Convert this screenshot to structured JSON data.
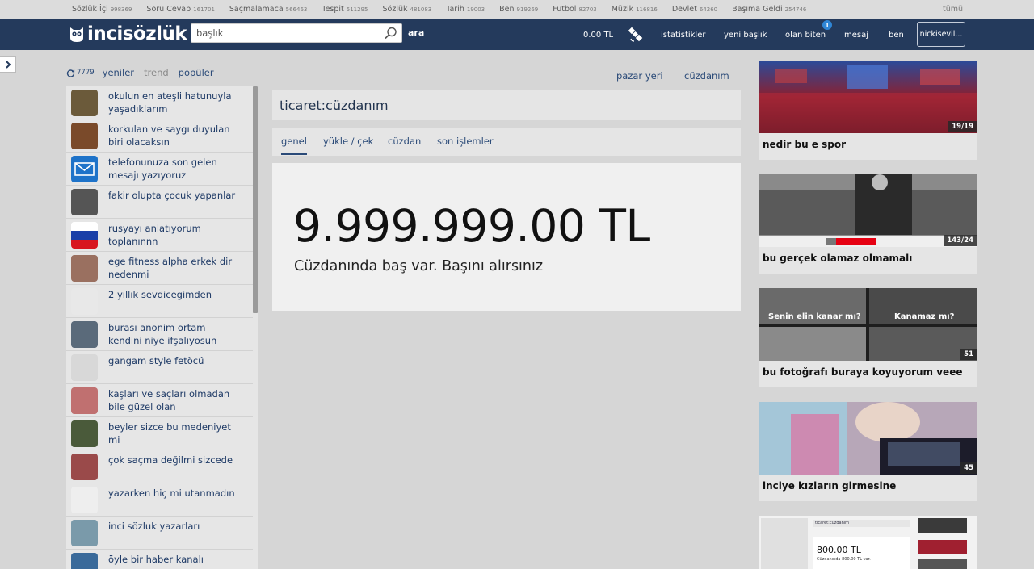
{
  "category_bar": {
    "items": [
      {
        "label": "Sözlük İçi",
        "count": "998369"
      },
      {
        "label": "Soru Cevap",
        "count": "161701"
      },
      {
        "label": "Saçmalamaca",
        "count": "566463"
      },
      {
        "label": "Tespit",
        "count": "511295"
      },
      {
        "label": "Sözlük",
        "count": "481083"
      },
      {
        "label": "Tarih",
        "count": "19003"
      },
      {
        "label": "Ben",
        "count": "919269"
      },
      {
        "label": "Futbol",
        "count": "82703"
      },
      {
        "label": "Müzik",
        "count": "116816"
      },
      {
        "label": "Devlet",
        "count": "64260"
      },
      {
        "label": "Başıma Geldi",
        "count": "254746"
      }
    ],
    "all_label": "tümü"
  },
  "header": {
    "logo": "incisözlük",
    "search_placeholder": "başlık",
    "search_button": "ara",
    "balance": "0.00 TL",
    "nav_stats": "istatistikler",
    "nav_new_title": "yeni başlık",
    "nav_news": "olan biten",
    "news_badge": "1",
    "nav_messages": "mesaj",
    "nav_me": "ben",
    "nick": "nickisevil..."
  },
  "left": {
    "refresh_count": "7779",
    "tab_new": "yeniler",
    "tab_trend": "trend",
    "tab_popular": "popüler",
    "topics": [
      {
        "title": "okulun en ateşli hatunuyla yaşadıklarım",
        "thumb": "#6b5a3a"
      },
      {
        "title": "korkulan ve saygı duyulan biri olacaksın",
        "thumb": "#7a4a2a"
      },
      {
        "title": "telefonunuza son gelen mesajı yazıyoruz",
        "thumb": "#1e73c9"
      },
      {
        "title": "fakir olupta çocuk yapanlar",
        "thumb": "#555555"
      },
      {
        "title": "rusyayı anlatıyorum toplanınnn",
        "thumb": "#ffffff"
      },
      {
        "title": "ege fitness alpha erkek dir nedenmi",
        "thumb": "#9a7060"
      },
      {
        "title": "2 yıllık sevdicegimden",
        "thumb": "#e8e8e8"
      },
      {
        "title": "burası anonim ortam kendini niye ifşalıyosun",
        "thumb": "#5a6a7a"
      },
      {
        "title": "gangam style fetöcü",
        "thumb": "#d8d8d8"
      },
      {
        "title": "kaşları ve saçları olmadan bile güzel olan",
        "thumb": "#c07070"
      },
      {
        "title": "beyler sizce bu medeniyet mi",
        "thumb": "#4a5a3a"
      },
      {
        "title": "çok saçma değilmi sizcede",
        "thumb": "#9a4a4a"
      },
      {
        "title": "yazarken hiç mi utanmadın",
        "thumb": "#eeeeee"
      },
      {
        "title": "inci sözluk yazarları",
        "thumb": "#7a9aaa"
      },
      {
        "title": "öyle bir haber kanalı",
        "thumb": "#3a6a9a"
      }
    ]
  },
  "center": {
    "link_market": "pazar yeri",
    "link_wallet": "cüzdanım",
    "title": "ticaret:cüzdanım",
    "tabs": [
      "genel",
      "yükle / çek",
      "cüzdan",
      "son işlemler"
    ],
    "amount": "9.999.999.00 TL",
    "note": "Cüzdanında baş var. Başını alırsınız"
  },
  "right": {
    "cards": [
      {
        "title": "nedir bu e spor",
        "count": "19/19"
      },
      {
        "title": "bu gerçek olamaz olmamalı",
        "count": "143/24"
      },
      {
        "title": "bu fotoğrafı buraya koyuyorum veee",
        "count": "51",
        "caption_left": "Senin elin kanar mı?",
        "caption_right": "Kanamaz mı?"
      },
      {
        "title": "inciye kızların girmesine",
        "count": "45"
      }
    ],
    "preview_amount": "800.00 TL",
    "preview_title": "ticaret:cüzdanım",
    "preview_small": "Cüzdanında 800.00 TL var."
  }
}
